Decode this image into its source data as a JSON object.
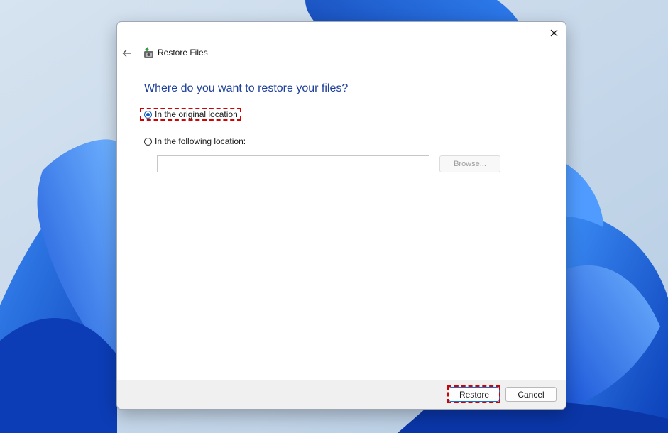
{
  "dialog": {
    "title": "Restore Files",
    "heading": "Where do you want to restore your files?",
    "options": [
      {
        "label": "In the original location",
        "checked": true
      },
      {
        "label": "In the following location:",
        "checked": false
      }
    ],
    "location_input": {
      "value": "",
      "placeholder": ""
    },
    "browse_label": "Browse...",
    "restore_label": "Restore",
    "cancel_label": "Cancel"
  },
  "icons": {
    "close": "close-icon",
    "back": "back-arrow-icon",
    "app": "restore-files-icon"
  },
  "colors": {
    "heading": "#1e3f9a",
    "accent": "#0f5fbf",
    "highlight": "#d20000",
    "wallpaper_bloom": "#1a5fe0"
  }
}
